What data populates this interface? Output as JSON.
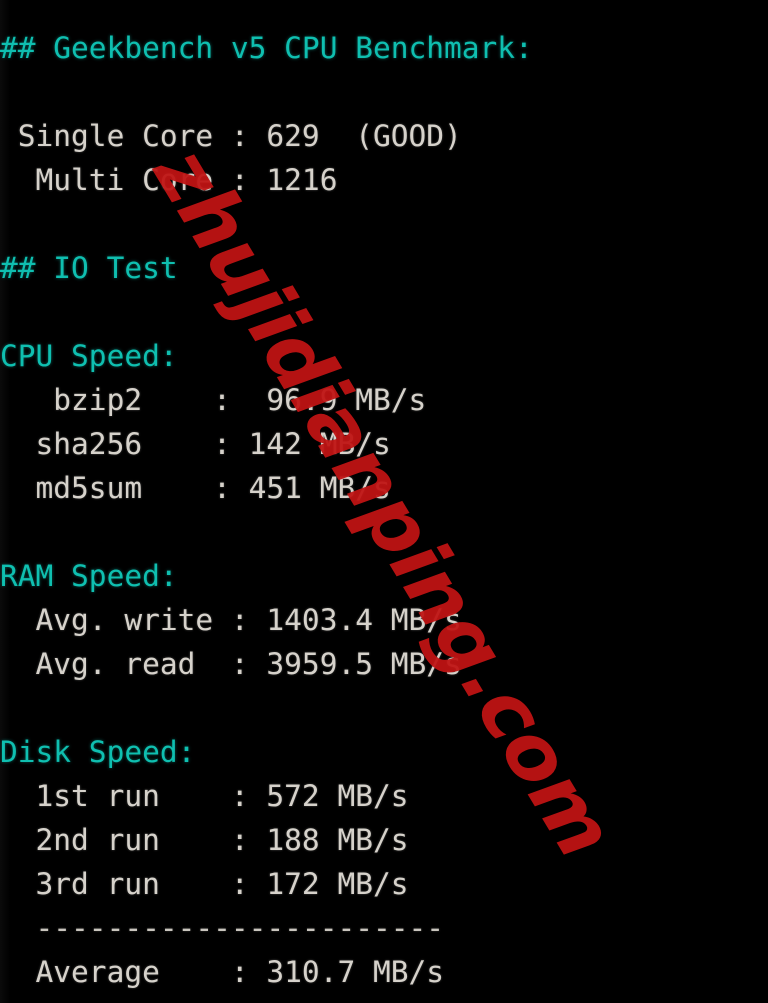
{
  "terminal": {
    "background_color": "#000000",
    "heading_color": "#0fbfb0",
    "text_color": "#d6d2cb",
    "watermark_color": "#c01414",
    "watermark_text": "zhujidianping.com"
  },
  "lines": [
    {
      "id": "geekbench-heading",
      "style": "heading",
      "text": "## Geekbench v5 CPU Benchmark:"
    },
    {
      "id": "blank-1",
      "style": "blank",
      "text": " "
    },
    {
      "id": "single-core-line",
      "style": "body-line",
      "text": " Single Core : 629  (GOOD)"
    },
    {
      "id": "multi-core-line",
      "style": "body-line",
      "text": "  Multi Core : 1216"
    },
    {
      "id": "blank-2",
      "style": "blank",
      "text": " "
    },
    {
      "id": "io-test-heading",
      "style": "heading",
      "text": "## IO Test"
    },
    {
      "id": "blank-3",
      "style": "blank",
      "text": " "
    },
    {
      "id": "cpu-speed-heading",
      "style": "heading",
      "text": "CPU Speed:"
    },
    {
      "id": "bzip2-line",
      "style": "body-line",
      "text": "   bzip2    :  96.9 MB/s"
    },
    {
      "id": "sha256-line",
      "style": "body-line",
      "text": "  sha256    : 142 MB/s"
    },
    {
      "id": "md5sum-line",
      "style": "body-line",
      "text": "  md5sum    : 451 MB/s"
    },
    {
      "id": "blank-4",
      "style": "blank",
      "text": " "
    },
    {
      "id": "ram-speed-heading",
      "style": "heading",
      "text": "RAM Speed:"
    },
    {
      "id": "ram-avg-write-line",
      "style": "body-line",
      "text": "  Avg. write : 1403.4 MB/s"
    },
    {
      "id": "ram-avg-read-line",
      "style": "body-line",
      "text": "  Avg. read  : 3959.5 MB/s"
    },
    {
      "id": "blank-5",
      "style": "blank",
      "text": " "
    },
    {
      "id": "disk-speed-heading",
      "style": "heading",
      "text": "Disk Speed:"
    },
    {
      "id": "disk-1st-run-line",
      "style": "body-line",
      "text": "  1st run    : 572 MB/s"
    },
    {
      "id": "disk-2nd-run-line",
      "style": "body-line",
      "text": "  2nd run    : 188 MB/s"
    },
    {
      "id": "disk-3rd-run-line",
      "style": "body-line",
      "text": "  3rd run    : 172 MB/s"
    },
    {
      "id": "disk-separator-line",
      "style": "rule-line",
      "text": "  -----------------------"
    },
    {
      "id": "disk-average-line",
      "style": "body-line",
      "text": "  Average    : 310.7 MB/s"
    }
  ],
  "results": {
    "geekbench_v5": {
      "section_title": "## Geekbench v5 CPU Benchmark:",
      "single_core_label": "Single Core",
      "single_core_value": "629",
      "single_core_rating": "(GOOD)",
      "multi_core_label": "Multi Core",
      "multi_core_value": "1216"
    },
    "io_test": {
      "section_title": "## IO Test",
      "cpu_speed": {
        "title": "CPU Speed:",
        "rows": [
          {
            "label": "bzip2",
            "value": "96.9 MB/s"
          },
          {
            "label": "sha256",
            "value": "142 MB/s"
          },
          {
            "label": "md5sum",
            "value": "451 MB/s"
          }
        ]
      },
      "ram_speed": {
        "title": "RAM Speed:",
        "rows": [
          {
            "label": "Avg. write",
            "value": "1403.4 MB/s"
          },
          {
            "label": "Avg. read",
            "value": "3959.5 MB/s"
          }
        ]
      },
      "disk_speed": {
        "title": "Disk Speed:",
        "rows": [
          {
            "label": "1st run",
            "value": "572 MB/s"
          },
          {
            "label": "2nd run",
            "value": "188 MB/s"
          },
          {
            "label": "3rd run",
            "value": "172 MB/s"
          }
        ],
        "separator": "-----------------------",
        "average_label": "Average",
        "average_value": "310.7 MB/s"
      }
    }
  }
}
